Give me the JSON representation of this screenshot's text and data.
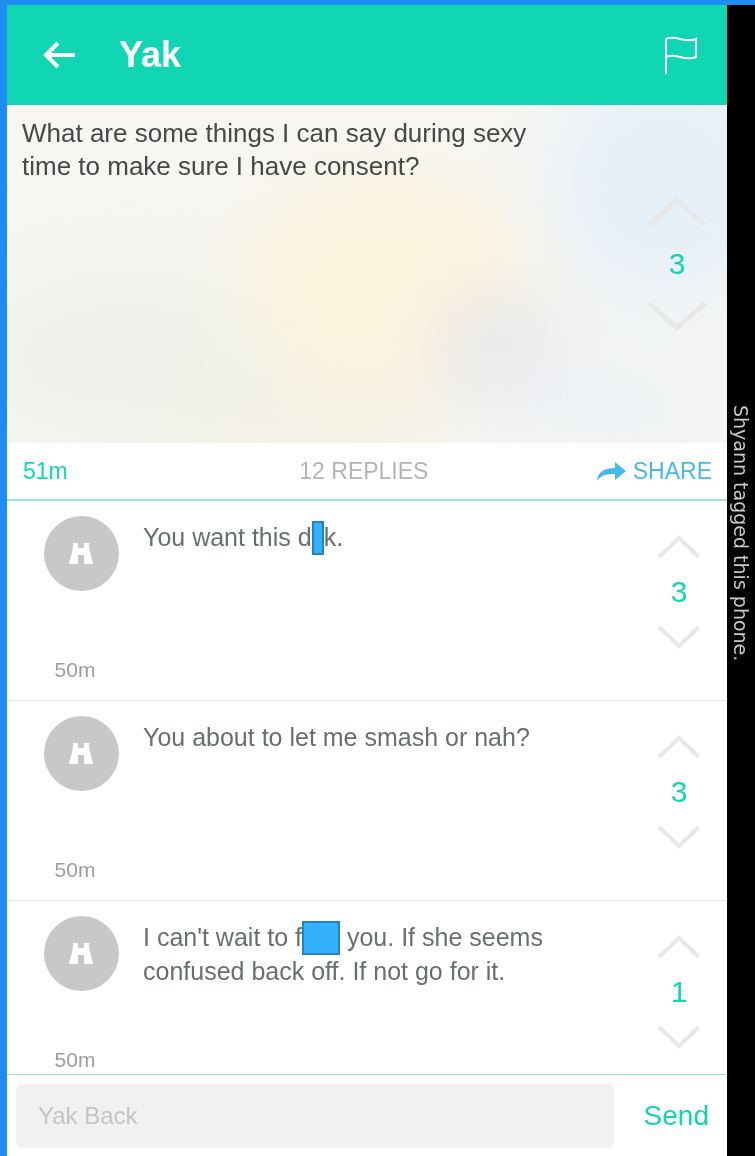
{
  "header": {
    "title": "Yak"
  },
  "post": {
    "text": "What are some things I can say during sexy time to make sure I have consent?",
    "votes": "3"
  },
  "meta": {
    "time": "51m",
    "replies": "12 REPLIES",
    "share": "SHARE"
  },
  "replies": [
    {
      "parts": [
        "You want this d",
        "k."
      ],
      "time": "50m",
      "votes": "3"
    },
    {
      "parts": [
        "You about to let me smash or nah?"
      ],
      "time": "50m",
      "votes": "3"
    },
    {
      "parts": [
        "I can't wait to f",
        " you. If she seems confused back off. If not go for it."
      ],
      "time": "50m",
      "votes": "1"
    }
  ],
  "composer": {
    "placeholder": "Yak Back",
    "send": "Send"
  },
  "side_note": "Shyann tagged this phone."
}
